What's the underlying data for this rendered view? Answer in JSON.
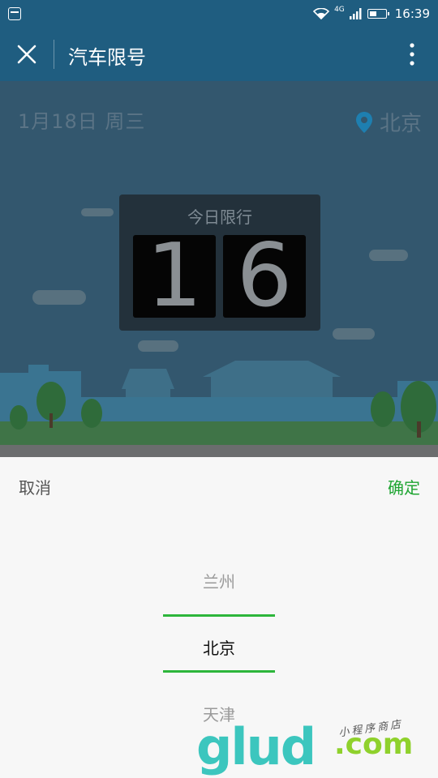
{
  "status_bar": {
    "network": "4G",
    "time": "16:39"
  },
  "header": {
    "title": "汽车限号"
  },
  "scene": {
    "date": "1月18日  周三",
    "city": "北京",
    "board": {
      "caption": "今日限行",
      "digits": [
        "1",
        "6"
      ]
    }
  },
  "sheet": {
    "cancel_label": "取消",
    "confirm_label": "确定",
    "picker": {
      "above": "兰州",
      "selected": "北京",
      "below": "天津"
    }
  },
  "watermark": {
    "brand": "glud",
    "domain": ".com",
    "tagline": "小程序商店"
  },
  "colors": {
    "primary": "#1f5d80",
    "accent": "#1fa532",
    "scene_bg": "#33576e"
  }
}
